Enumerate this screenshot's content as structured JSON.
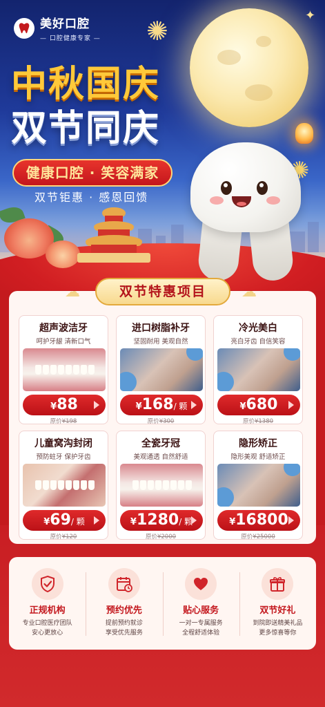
{
  "brand": {
    "name": "美好口腔",
    "tagline": "— 口腔健康专家 —"
  },
  "hero": {
    "headline_1": "中秋国庆",
    "headline_2": "双节同庆",
    "ribbon": "健康口腔 · 笑容满家",
    "subtitle": "双节钜惠 · 感恩回馈"
  },
  "section": {
    "title": "双节特惠项目"
  },
  "services": [
    {
      "title": "超声波洁牙",
      "desc": "呵护牙龈 清新口气",
      "currency": "¥",
      "price": "88",
      "unit": "",
      "orig_label": "原价",
      "orig_price": "¥198",
      "image": "teeth"
    },
    {
      "title": "进口树脂补牙",
      "desc": "坚固耐用 美观自然",
      "currency": "¥",
      "price": "168",
      "unit": "/ 颗",
      "orig_label": "原价",
      "orig_price": "¥300",
      "image": "dental"
    },
    {
      "title": "冷光美白",
      "desc": "亮白牙齿 自信笑容",
      "currency": "¥",
      "price": "680",
      "unit": "",
      "orig_label": "原价",
      "orig_price": "¥1380",
      "image": "dental"
    },
    {
      "title": "儿童窝沟封闭",
      "desc": "预防蛀牙 保护牙齿",
      "currency": "¥",
      "price": "69",
      "unit": "/ 颗",
      "orig_label": "原价",
      "orig_price": "¥120",
      "image": "smile"
    },
    {
      "title": "全瓷牙冠",
      "desc": "美观通透 自然舒适",
      "currency": "¥",
      "price": "1280",
      "unit": "/ 颗",
      "orig_label": "原价",
      "orig_price": "¥2000",
      "image": "teeth"
    },
    {
      "title": "隐形矫正",
      "desc": "隐形美观 舒适矫正",
      "currency": "¥",
      "price": "16800",
      "unit": "",
      "orig_label": "原价",
      "orig_price": "¥25000",
      "image": "dental"
    }
  ],
  "features": [
    {
      "icon": "shield-check-icon",
      "title": "正规机构",
      "line1": "专业口腔医疗团队",
      "line2": "安心更放心"
    },
    {
      "icon": "calendar-clock-icon",
      "title": "预约优先",
      "line1": "提前预约就诊",
      "line2": "享受优先服务"
    },
    {
      "icon": "heart-icon",
      "title": "贴心服务",
      "line1": "一对一专属服务",
      "line2": "全程舒适体验"
    },
    {
      "icon": "gift-icon",
      "title": "双节好礼",
      "line1": "到院即送精美礼品",
      "line2": "更多惊喜等你"
    }
  ],
  "colors": {
    "primary_red": "#c41a1e",
    "gold": "#ffc93a",
    "navy": "#13246e"
  }
}
